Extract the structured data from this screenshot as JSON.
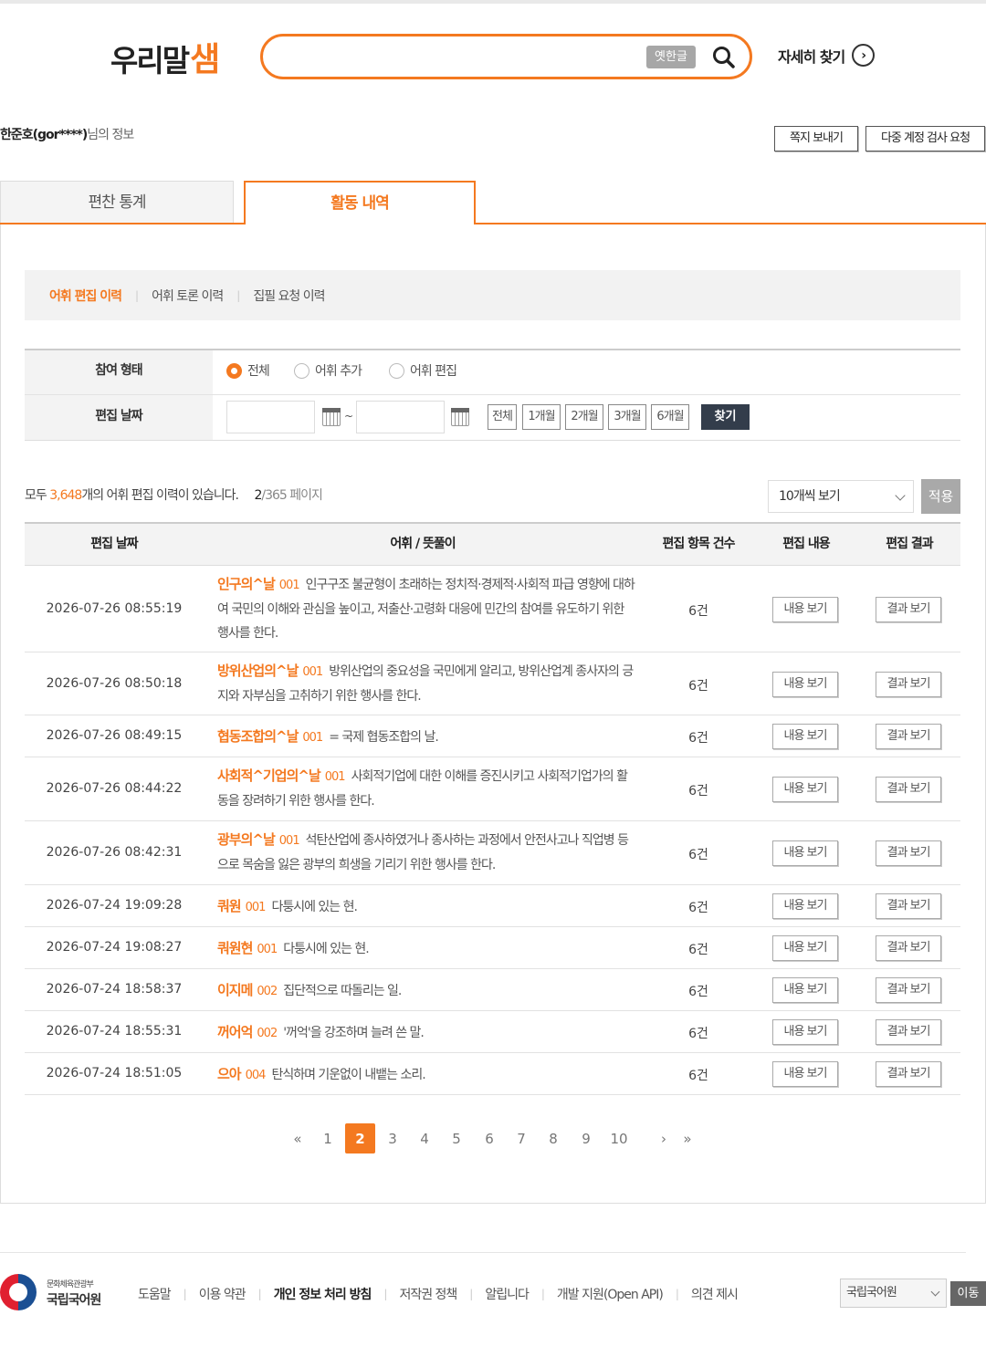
{
  "header": {
    "logo_word": "우리말",
    "logo_accent": "샘",
    "search_value": "",
    "search_placeholder": "",
    "old_hangul_label": "옛한글",
    "detail_search_label": "자세히 찾기"
  },
  "user": {
    "name": "한준호(gor****)",
    "suffix": "님의 정보",
    "send_message_label": "쪽지 보내기",
    "multi_account_label": "다중 계정 검사 요청"
  },
  "tabs": [
    {
      "label": "편찬 통계",
      "active": false
    },
    {
      "label": "활동 내역",
      "active": true
    }
  ],
  "subtabs": [
    {
      "label": "어휘 편집 이력",
      "active": true
    },
    {
      "label": "어휘 토론 이력",
      "active": false
    },
    {
      "label": "집필 요청 이력",
      "active": false
    }
  ],
  "filter": {
    "type_label": "참여 형태",
    "date_label": "편집 날짜",
    "options": [
      {
        "label": "전체",
        "selected": true
      },
      {
        "label": "어휘 추가",
        "selected": false
      },
      {
        "label": "어휘 편집",
        "selected": false
      }
    ],
    "date_from": "",
    "date_to": "",
    "date_sep": "~",
    "period_buttons": [
      "전체",
      "1개월",
      "2개월",
      "3개월",
      "6개월"
    ],
    "find_label": "찾기"
  },
  "summary": {
    "prefix": "모두 ",
    "count": "3,648",
    "suffix": "개의 어휘 편집 이력이 있습니다.",
    "current_page": "2",
    "total_pages": "/365 페이지",
    "per_page": "10개씩 보기",
    "apply_label": "적용"
  },
  "table": {
    "headers": [
      "편집 날짜",
      "어휘 / 뜻풀이",
      "편집 항목 건수",
      "편집 내용",
      "편집 결과"
    ],
    "view_content_label": "내용 보기",
    "view_result_label": "결과 보기",
    "rows": [
      {
        "date": "2026-07-26 08:55:19",
        "word": "인구의^날",
        "num": "001",
        "def": "인구구조 불균형이 초래하는 정치적·경제적·사회적 파급 영향에 대하여 국민의 이해와 관심을 높이고, 저출산·고령화 대응에 민간의 참여를 유도하기 위한 행사를 한다.",
        "count": "6건"
      },
      {
        "date": "2026-07-26 08:50:18",
        "word": "방위산업의^날",
        "num": "001",
        "def": "방위산업의 중요성을 국민에게 알리고, 방위산업계 종사자의 긍지와 자부심을 고취하기 위한 행사를 한다.",
        "count": "6건"
      },
      {
        "date": "2026-07-26 08:49:15",
        "word": "협동조합의^날",
        "num": "001",
        "def": "= 국제 협동조합의 날.",
        "count": "6건"
      },
      {
        "date": "2026-07-26 08:44:22",
        "word": "사회적^기업의^날",
        "num": "001",
        "def": "사회적기업에 대한 이해를 증진시키고 사회적기업가의 활동을 장려하기 위한 행사를 한다.",
        "count": "6건"
      },
      {
        "date": "2026-07-26 08:42:31",
        "word": "광부의^날",
        "num": "001",
        "def": "석탄산업에 종사하였거나 종사하는 과정에서 안전사고나 직업병 등으로 목숨을 잃은 광부의 희생을 기리기 위한 행사를 한다.",
        "count": "6건"
      },
      {
        "date": "2026-07-24 19:09:28",
        "word": "쿼원",
        "num": "001",
        "def": "다퉁시에 있는 현.",
        "count": "6건"
      },
      {
        "date": "2026-07-24 19:08:27",
        "word": "쿼원현",
        "num": "001",
        "def": "다퉁시에 있는 현.",
        "count": "6건"
      },
      {
        "date": "2026-07-24 18:58:37",
        "word": "이지메",
        "num": "002",
        "def": "집단적으로 따돌리는 일.",
        "count": "6건"
      },
      {
        "date": "2026-07-24 18:55:31",
        "word": "꺼어억",
        "num": "002",
        "def": "'꺼억'을 강조하며 늘려 쓴 말.",
        "count": "6건"
      },
      {
        "date": "2026-07-24 18:51:05",
        "word": "으아",
        "num": "004",
        "def": "탄식하며 기운없이 내뱉는 소리.",
        "count": "6건"
      }
    ]
  },
  "pagination": {
    "first": "«",
    "prev_label": "‹",
    "pages": [
      "1",
      "2",
      "3",
      "4",
      "5",
      "6",
      "7",
      "8",
      "9",
      "10"
    ],
    "current": "2",
    "next_label": "›",
    "last": "»"
  },
  "footer": {
    "org_small": "문화체육관광부",
    "org_name": "국립국어원",
    "links": [
      "도움말",
      "이용 약관",
      "개인 정보 처리 방침",
      "저작권 정책",
      "알립니다",
      "개발 지원(Open API)",
      "의견 제시"
    ],
    "site_select": "국립국어원",
    "go_label": "이동"
  },
  "colors": {
    "accent": "#f47920",
    "dark_button": "#333d4b"
  }
}
